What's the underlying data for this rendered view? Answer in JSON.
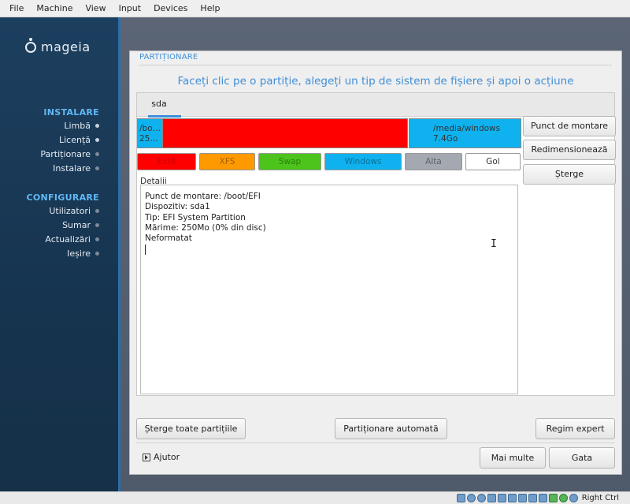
{
  "host_menu": [
    "File",
    "Machine",
    "View",
    "Input",
    "Devices",
    "Help"
  ],
  "brand": {
    "logo_text": "mageia"
  },
  "sidebar": {
    "section_install": "INSTALARE",
    "install_items": [
      {
        "label": "Limbă",
        "state": "done"
      },
      {
        "label": "Licență",
        "state": "done"
      },
      {
        "label": "Partiționare",
        "state": "current"
      },
      {
        "label": "Instalare",
        "state": "pending"
      }
    ],
    "section_configure": "CONFIGURARE",
    "configure_items": [
      {
        "label": "Utilizatori",
        "state": "pending"
      },
      {
        "label": "Sumar",
        "state": "pending"
      },
      {
        "label": "Actualizări",
        "state": "pending"
      },
      {
        "label": "Ieșire",
        "state": "pending"
      }
    ]
  },
  "dialog": {
    "title": "PARTIȚIONARE",
    "heading": "Faceți clic pe o partiție, alegeți un tip de sistem de fișiere și apoi o acțiune",
    "tab": "sda",
    "partitions": [
      {
        "line1": "/bo…",
        "line2": "25…",
        "color": "#0fb2ee",
        "type": "EFI"
      },
      {
        "line1": "",
        "line2": "",
        "color": "#ff0000",
        "type": "Ext4"
      },
      {
        "line1": "/media/windows",
        "line2": "7.4Go",
        "color": "#0fb2ee",
        "type": "Windows"
      }
    ],
    "legend": [
      {
        "label": "Ext4",
        "color": "#ff0000"
      },
      {
        "label": "XFS",
        "color": "#ff9900"
      },
      {
        "label": "Swap",
        "color": "#4cc41c"
      },
      {
        "label": "Windows",
        "color": "#0fb2ee"
      },
      {
        "label": "Alta",
        "color": "#a4a8b0"
      },
      {
        "label": "Gol",
        "color": "#ffffff"
      }
    ],
    "actions": {
      "mount_point": "Punct de montare",
      "resize": "Redimensionează",
      "delete": "Șterge"
    },
    "details_label": "Detalii",
    "details": [
      "Punct de montare: /boot/EFI",
      "Dispozitiv: sda1",
      "Tip: EFI System Partition",
      "Mărime: 250Mo (0% din disc)",
      "Neformatat"
    ],
    "bottom_buttons": {
      "clear_all": "Șterge toate partițiile",
      "auto": "Partiționare automată",
      "expert": "Regim expert"
    },
    "help": "Ajutor",
    "more": "Mai multe",
    "done": "Gata"
  },
  "host_status": {
    "right_ctrl": "Right Ctrl"
  }
}
